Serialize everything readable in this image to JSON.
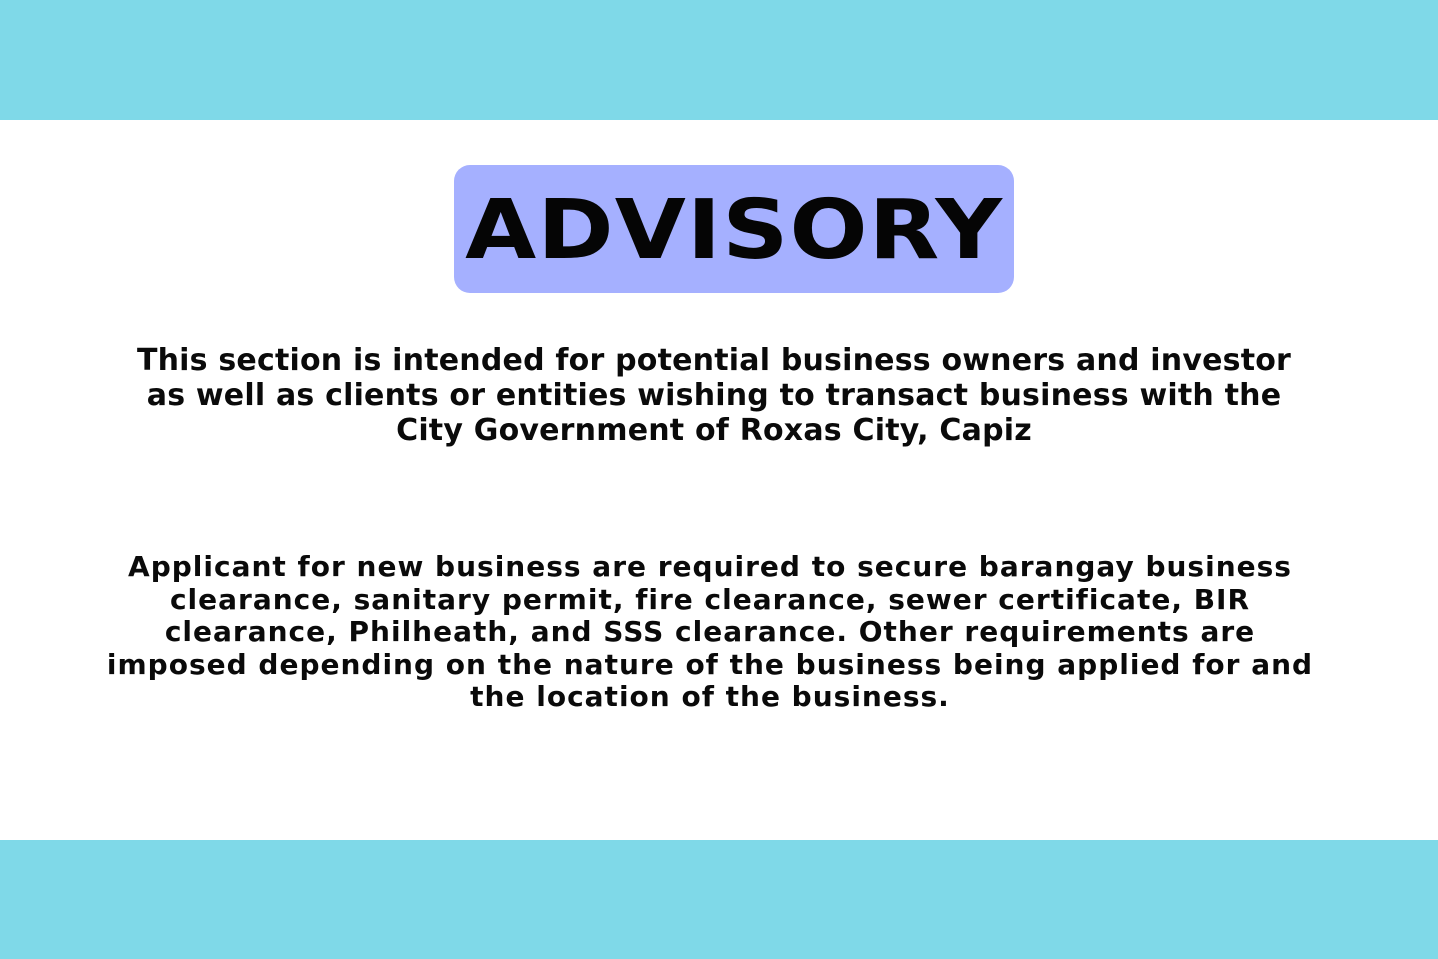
{
  "colors": {
    "band": "#7fd9e8",
    "badge": "#a5b0ff",
    "background": "#ffffff",
    "text": "#0a0a0a"
  },
  "header": {
    "title": "ADVISORY"
  },
  "intro": {
    "lines": [
      "This section is intended for potential business owners and investor",
      "as well as clients or entities wishing to transact business with the",
      "City Government of Roxas City, Capiz"
    ]
  },
  "requirements": {
    "lines": [
      "Applicant for new business are required to secure barangay business",
      "clearance, sanitary permit, fire clearance, sewer certificate, BIR",
      "clearance, Philheath, and SSS clearance. Other requirements are",
      "imposed depending on the nature of the business being applied for and",
      "the location of the business."
    ]
  }
}
